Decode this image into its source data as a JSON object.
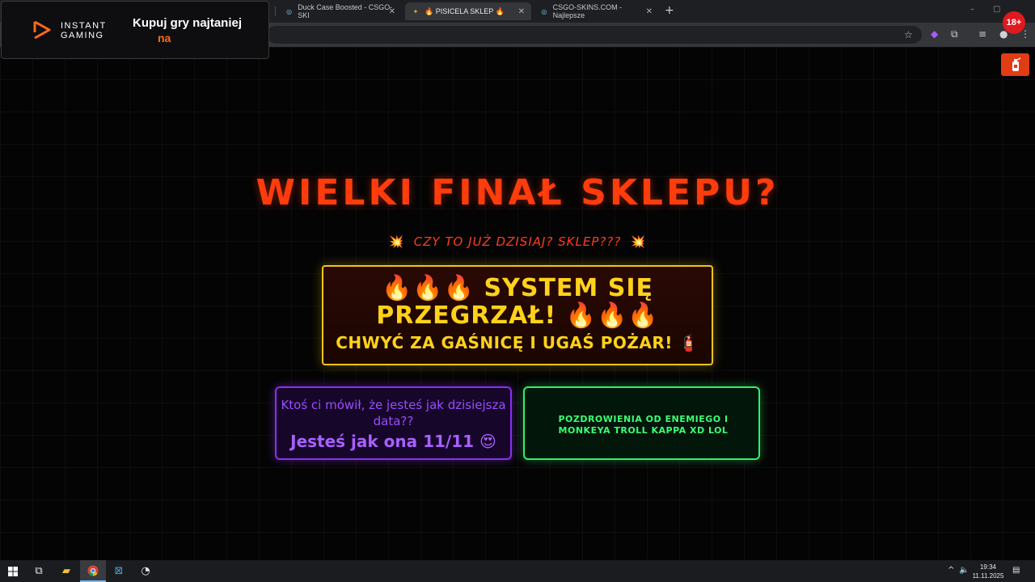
{
  "browser": {
    "tabs": [
      {
        "label": "Duck Case Boosted - CSGO-SKI",
        "icon": "globe-icon",
        "active": false
      },
      {
        "label": "🔥 PISICELA SKLEP 🔥",
        "icon": "favicon-icon",
        "active": true
      },
      {
        "label": "CSGO-SKINS.COM - Najlepsze",
        "icon": "globe-icon",
        "active": false
      }
    ],
    "new_tab_label": "+",
    "close_glyph": "✕"
  },
  "ad": {
    "brand_line1": "INSTANT",
    "brand_line2": "GAMING",
    "title": "Kupuj gry najtaniej",
    "subtitle": "na",
    "accent_color": "#ff6a18"
  },
  "age_badge": "18+",
  "page": {
    "title": "WIELKI FINAŁ SKLEPU?",
    "subtitle": "CZY TO JUŻ DZISIAJ? SKLEP???",
    "subtitle_icon": "💥",
    "alert": {
      "line1": "🔥🔥🔥 SYSTEM SIĘ PRZEGRZAŁ! 🔥🔥🔥",
      "line2": "CHWYĆ ZA GAŚNICĘ I UGAŚ POŻAR! 🧯"
    },
    "card_purple": {
      "line1": "Ktoś ci mówił, że jesteś jak dzisiejsza data??",
      "line2": "Jesteś jak ona 11/11 😍"
    },
    "card_green": {
      "text": "POZDROWIENIA OD ENEMIEGO I MONKEYA TROLL KAPPA XD LOL"
    },
    "colors": {
      "title": "#ff3c0c",
      "alert_border": "#f5c518",
      "purple": "#8c2ff0",
      "green": "#30f06a"
    }
  },
  "taskbar": {
    "time": "19:34",
    "date": "11.11.2025"
  }
}
